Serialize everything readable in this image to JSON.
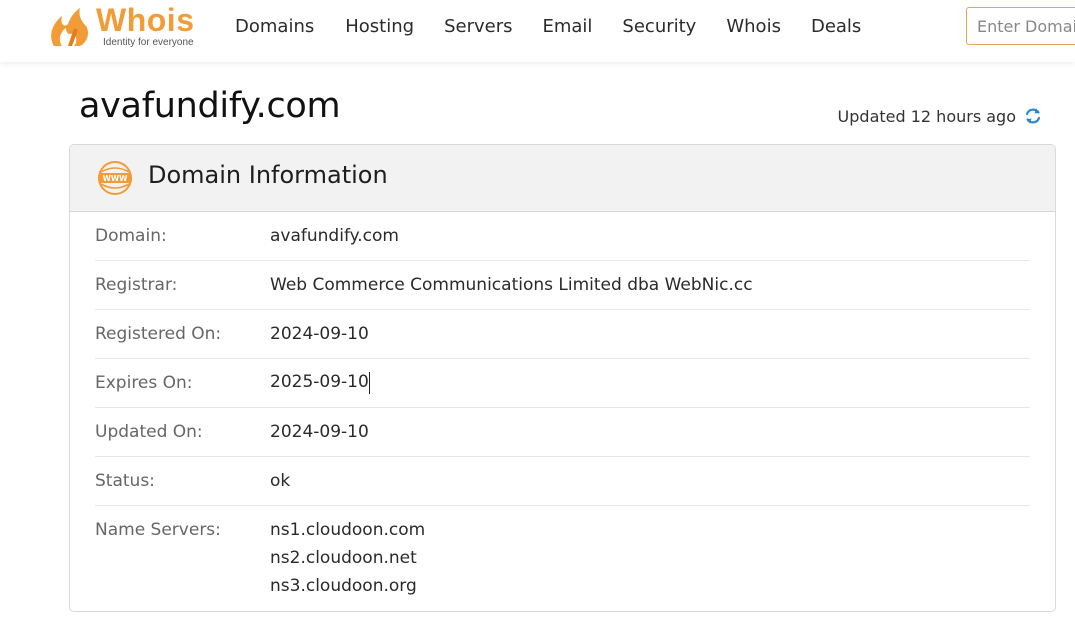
{
  "header": {
    "logo_text": "Whois",
    "logo_tagline": "Identity for everyone",
    "nav": [
      "Domains",
      "Hosting",
      "Servers",
      "Email",
      "Security",
      "Whois",
      "Deals"
    ],
    "search_placeholder": "Enter Domain"
  },
  "page": {
    "title": "avafundify.com",
    "updated_text": "Updated 12 hours ago"
  },
  "card": {
    "title": "Domain Information",
    "rows": [
      {
        "label": "Domain:",
        "value": "avafundify.com"
      },
      {
        "label": "Registrar:",
        "value": "Web Commerce Communications Limited dba WebNic.cc"
      },
      {
        "label": "Registered On:",
        "value": "2024-09-10"
      },
      {
        "label": "Expires On:",
        "value": "2025-09-10"
      },
      {
        "label": "Updated On:",
        "value": "2024-09-10"
      },
      {
        "label": "Status:",
        "value": "ok"
      }
    ],
    "name_servers_label": "Name Servers:",
    "name_servers": [
      "ns1.cloudoon.com",
      "ns2.cloudoon.net",
      "ns3.cloudoon.org"
    ]
  },
  "colors": {
    "brand": "#f29c38",
    "accent_blue": "#2e86c9",
    "card_header_bg": "#f2f2f2"
  },
  "icons": {
    "logo": "whois-flame-logo",
    "refresh": "refresh-icon",
    "www": "www-globe-icon"
  }
}
